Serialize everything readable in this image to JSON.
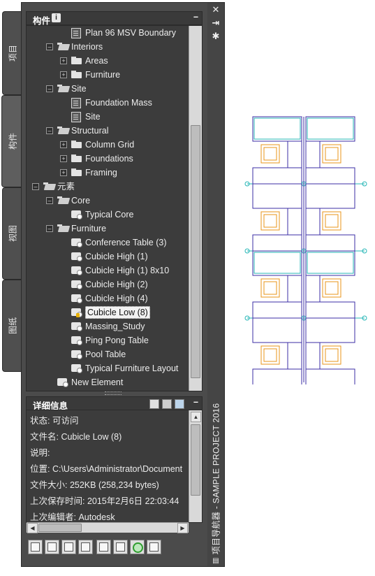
{
  "side_tabs": [
    {
      "label": "项目",
      "active": false
    },
    {
      "label": "构件",
      "active": true
    },
    {
      "label": "视图",
      "active": false
    },
    {
      "label": "图纸",
      "active": false
    }
  ],
  "palette": {
    "vertical_title": "项目导航器 - SAMPLE PROJECT 2016",
    "strip_icons": [
      "close-icon",
      "pin-icon",
      "settings-icon"
    ],
    "bottom_icon": "menu-icon"
  },
  "tree_section": {
    "title": "构件",
    "info_icon": "i",
    "minimize_glyph": "–"
  },
  "tree": [
    {
      "label": "Plan 96 MSV Boundary",
      "type": "file"
    },
    {
      "label": "Interiors",
      "type": "folder-open",
      "toggle": "–"
    },
    {
      "label": "Areas",
      "type": "folder",
      "toggle": "+"
    },
    {
      "label": "Furniture",
      "type": "folder",
      "toggle": "+"
    },
    {
      "label": "Site",
      "type": "folder-open",
      "toggle": "–"
    },
    {
      "label": "Foundation Mass",
      "type": "file"
    },
    {
      "label": "Site",
      "type": "file"
    },
    {
      "label": "Structural",
      "type": "folder-open",
      "toggle": "–"
    },
    {
      "label": "Column Grid",
      "type": "folder",
      "toggle": "+"
    },
    {
      "label": "Foundations",
      "type": "folder",
      "toggle": "+"
    },
    {
      "label": "Framing",
      "type": "folder",
      "toggle": "+"
    },
    {
      "label": "元素",
      "type": "folder-open",
      "toggle": "–"
    },
    {
      "label": "Core",
      "type": "folder-open",
      "toggle": "–"
    },
    {
      "label": "Typical Core",
      "type": "element"
    },
    {
      "label": "Furniture",
      "type": "folder-open",
      "toggle": "–"
    },
    {
      "label": "Conference Table (3)",
      "type": "element"
    },
    {
      "label": "Cubicle High (1)",
      "type": "element"
    },
    {
      "label": "Cubicle High (1) 8x10",
      "type": "element"
    },
    {
      "label": "Cubicle High (2)",
      "type": "element"
    },
    {
      "label": "Cubicle High (4)",
      "type": "element"
    },
    {
      "label": "Cubicle Low (8)",
      "type": "element",
      "selected": true,
      "locked": true
    },
    {
      "label": "Massing_Study",
      "type": "element"
    },
    {
      "label": "Ping Pong Table",
      "type": "element"
    },
    {
      "label": "Pool Table",
      "type": "element"
    },
    {
      "label": "Typical Furniture Layout",
      "type": "element"
    },
    {
      "label": "New Element",
      "type": "element"
    }
  ],
  "details_section": {
    "title": "详细信息",
    "minimize_glyph": "–",
    "rows": [
      "状态: 可访问",
      "文件名: Cubicle Low (8)",
      "说明:",
      "位置: C:\\Users\\Administrator\\Document",
      "文件大小: 252KB (258,234 bytes)",
      "上次保存时间: 2015年2月6日   22:03:44",
      "上次编辑者: Autodesk"
    ]
  },
  "toolbar": [
    "new-element-icon",
    "new-file-icon",
    "new-element-view-icon",
    "copy-icon",
    "select-icon",
    "properties-icon",
    "refresh-icon",
    "export-icon"
  ],
  "colors": {
    "panel_dark": "#3c3c3c",
    "plan_purple": "#3b2ea6",
    "plan_cyan": "#25b6b6",
    "plan_orange": "#e8941a"
  }
}
